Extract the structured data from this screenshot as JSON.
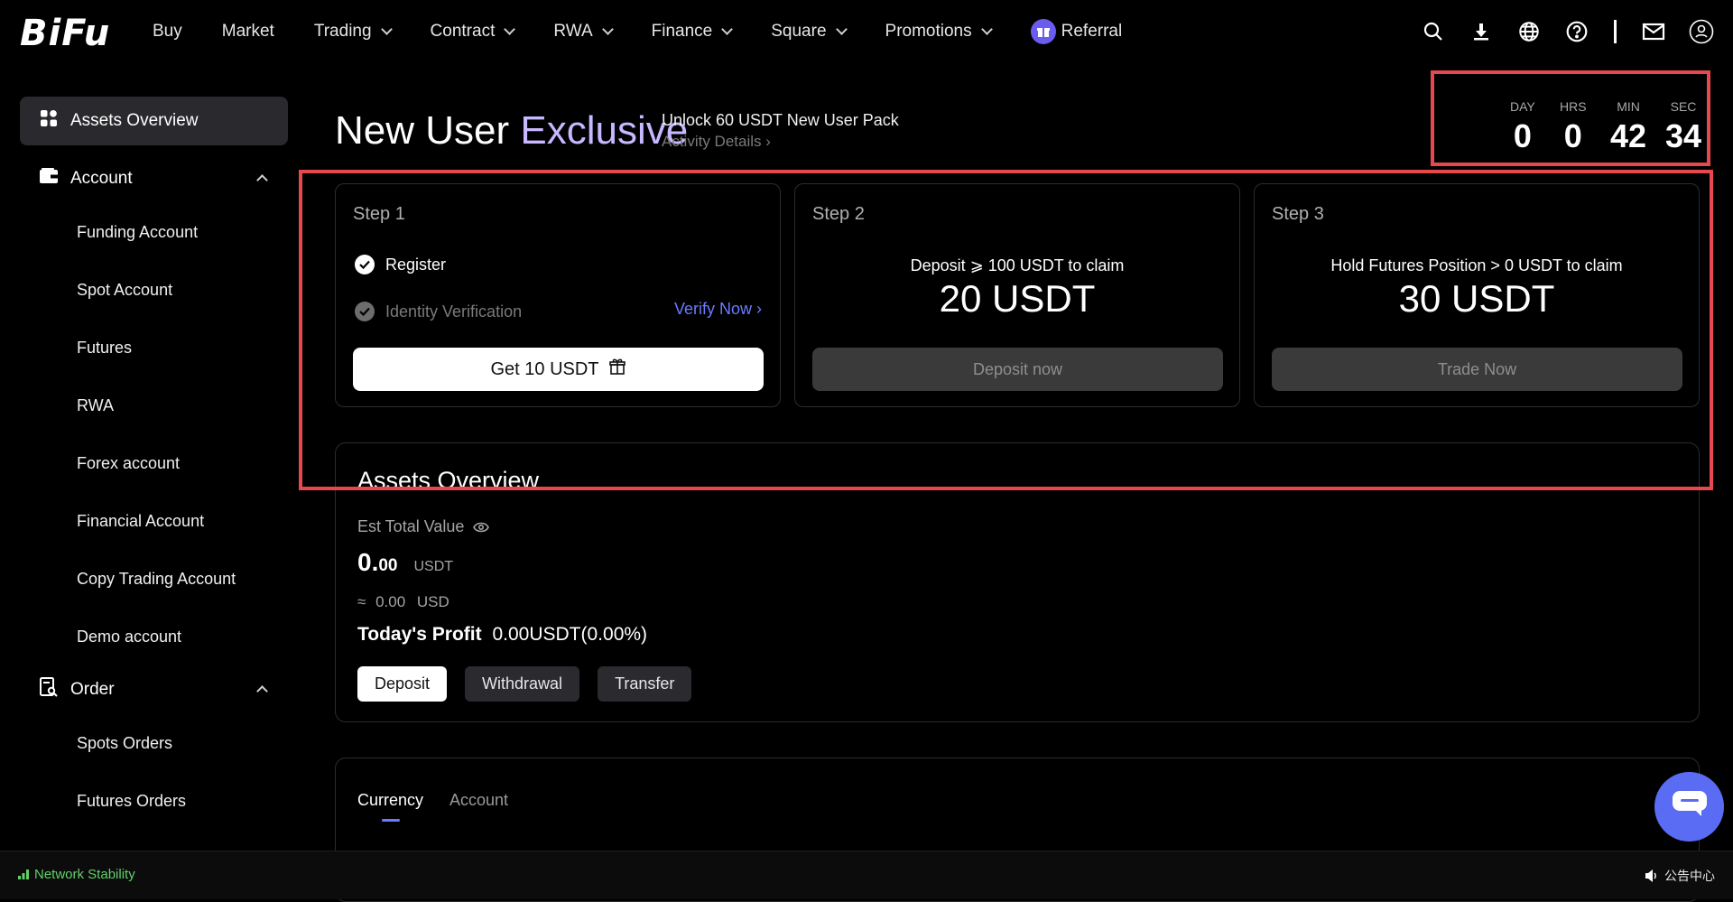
{
  "brand": {
    "logo_text": "BiFu"
  },
  "nav": {
    "items": [
      {
        "label": "Buy",
        "dropdown": false
      },
      {
        "label": "Market",
        "dropdown": false
      },
      {
        "label": "Trading",
        "dropdown": true
      },
      {
        "label": "Contract",
        "dropdown": true
      },
      {
        "label": "RWA",
        "dropdown": true
      },
      {
        "label": "Finance",
        "dropdown": true
      },
      {
        "label": "Square",
        "dropdown": true
      },
      {
        "label": "Promotions",
        "dropdown": true
      }
    ],
    "referral_label": "Referral",
    "icons": [
      "search-icon",
      "download-icon",
      "globe-icon",
      "help-icon",
      "mail-icon",
      "user-icon"
    ]
  },
  "sidebar": {
    "overview_label": "Assets Overview",
    "account_label": "Account",
    "account_items": [
      "Funding Account",
      "Spot Account",
      "Futures",
      "RWA",
      "Forex account",
      "Financial Account",
      "Copy Trading Account",
      "Demo account"
    ],
    "order_label": "Order",
    "order_items": [
      "Spots Orders",
      "Futures Orders"
    ]
  },
  "promo": {
    "title_plain": "New User",
    "title_accent": "Exclusive",
    "subtitle": "Unlock 60 USDT New User Pack",
    "details_link": "Activity Details"
  },
  "countdown": {
    "labels": {
      "day": "DAY",
      "hrs": "HRS",
      "min": "MIN",
      "sec": "SEC"
    },
    "values": {
      "day": "0",
      "hrs": "0",
      "min": "42",
      "sec": "34"
    }
  },
  "steps": {
    "step1": {
      "title": "Step 1",
      "register": "Register",
      "identity": "Identity Verification",
      "verify": "Verify Now",
      "button": "Get 10 USDT"
    },
    "step2": {
      "title": "Step 2",
      "claim_text": "Deposit ⩾ 100 USDT to claim",
      "reward": "20 USDT",
      "button": "Deposit now"
    },
    "step3": {
      "title": "Step 3",
      "claim_text": "Hold Futures Position > 0 USDT to claim",
      "reward": "30 USDT",
      "button": "Trade Now"
    }
  },
  "assets": {
    "title": "Assets Overview",
    "est_label": "Est Total Value",
    "total_int": "0.",
    "total_dec": "00",
    "total_unit": "USDT",
    "approx_symbol": "≈",
    "approx_value": "0.00",
    "approx_unit": "USD",
    "profit_label": "Today's Profit",
    "profit_value": "0.00USDT(0.00%)",
    "buttons": {
      "deposit": "Deposit",
      "withdrawal": "Withdrawal",
      "transfer": "Transfer"
    }
  },
  "tabs": {
    "currency": "Currency",
    "account": "Account"
  },
  "footer": {
    "network": "Network Stability",
    "notice": "公告中心"
  },
  "colors": {
    "accent": "#6a7bff",
    "promo_accent": "#c7b8ff",
    "highlight": "#e5484d",
    "network": "#5fd16a"
  }
}
